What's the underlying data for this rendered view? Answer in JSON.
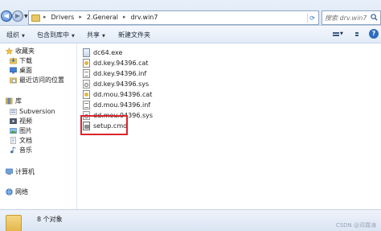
{
  "address_bar": {
    "breadcrumbs": [
      "Drivers",
      "2.General",
      "drv.win7"
    ],
    "separator": "▸",
    "search_placeholder": "搜索 drv.win7"
  },
  "toolbar": {
    "organize": "组织",
    "include_in_library": "包含到库中",
    "share": "共享",
    "new_folder": "新建文件夹"
  },
  "nav_pane": {
    "favorites": {
      "label": "收藏夹",
      "items": [
        "下载",
        "桌面",
        "最近访问的位置"
      ]
    },
    "libraries": {
      "label": "库",
      "items": [
        "Subversion",
        "视频",
        "图片",
        "文档",
        "音乐"
      ]
    },
    "computer": "计算机",
    "network": "网络"
  },
  "files": [
    {
      "name": "dc64.exe",
      "type": "exe"
    },
    {
      "name": "dd.key.94396.cat",
      "type": "cat"
    },
    {
      "name": "dd.key.94396.inf",
      "type": "inf"
    },
    {
      "name": "dd.key.94396.sys",
      "type": "sys"
    },
    {
      "name": "dd.mou.94396.cat",
      "type": "cat"
    },
    {
      "name": "dd.mou.94396.inf",
      "type": "inf"
    },
    {
      "name": "dd.mou.94396.sys",
      "type": "sys"
    },
    {
      "name": "setup.cmd",
      "type": "cmd",
      "highlighted": true
    }
  ],
  "status_bar": {
    "item_count": "8 个对象"
  },
  "watermark": "CSDN @邓霖涛",
  "colors": {
    "highlight_border": "#d9262d",
    "accent": "#2f6cc0"
  }
}
